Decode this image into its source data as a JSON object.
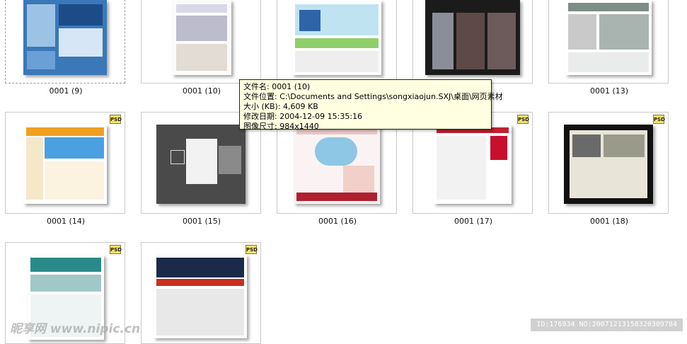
{
  "tiles": [
    {
      "caption": "0001 (9)"
    },
    {
      "caption": "0001 (10)"
    },
    {
      "caption": ""
    },
    {
      "caption": ""
    },
    {
      "caption": "0001 (13)"
    },
    {
      "caption": "0001 (14)"
    },
    {
      "caption": "0001 (15)"
    },
    {
      "caption": "0001 (16)"
    },
    {
      "caption": "0001 (17)"
    },
    {
      "caption": "0001 (18)"
    },
    {
      "caption": ""
    },
    {
      "caption": ""
    }
  ],
  "badge": "PSD",
  "tooltip": {
    "name": "文件名: 0001 (10)",
    "location": "文件位置: C:\\Documents and Settings\\songxiaojun.SXJ\\桌面\\网页素材",
    "size": "大小 (KB): 4,609 KB",
    "modified": "修改日期: 2004-12-09 15:35:16",
    "dimensions": "图像尺寸: 984x1440"
  },
  "watermark": {
    "left": "昵享网 www.nipic.cn",
    "right": "ID:176934 NO:20071213158320309784"
  },
  "colors": {
    "tooltip_bg": "#ffffe1",
    "psd_badge": "#f6e26a"
  }
}
